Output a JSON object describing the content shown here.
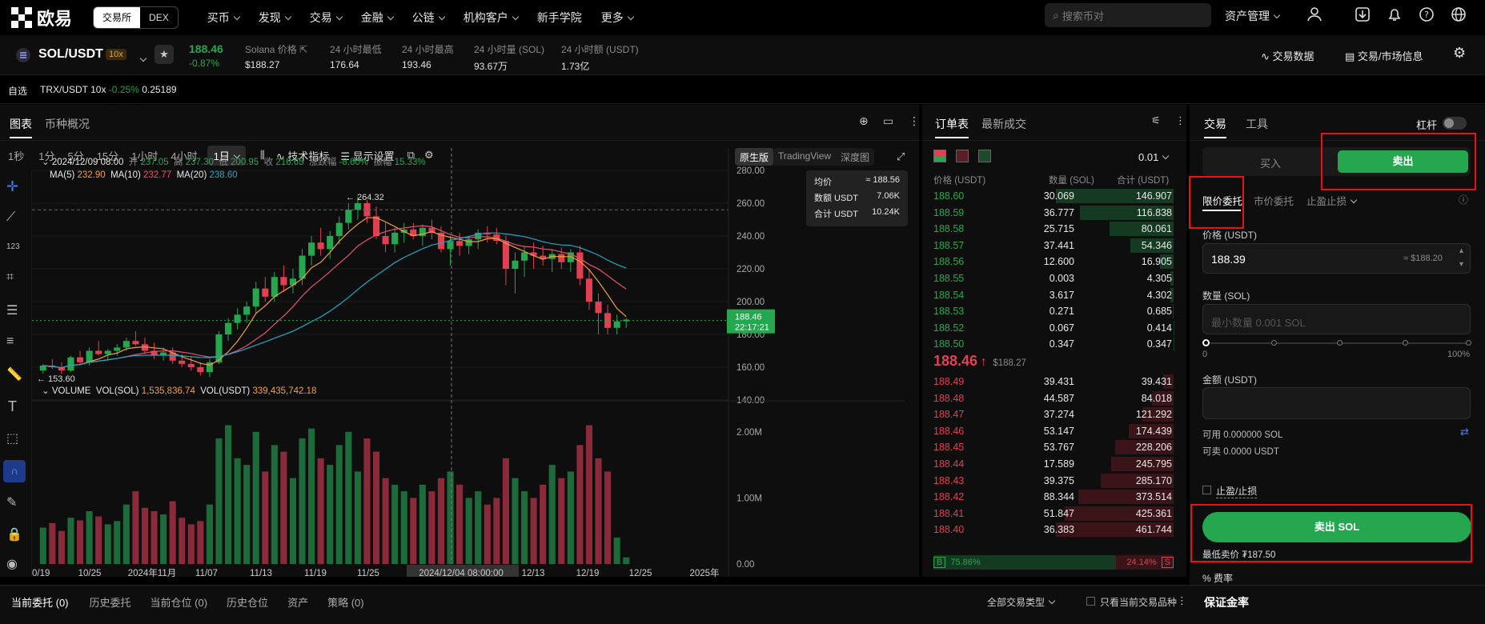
{
  "topnav": {
    "brand": "欧易",
    "seg": [
      "交易所",
      "DEX"
    ],
    "menu": [
      "买币",
      "发现",
      "交易",
      "金融",
      "公链",
      "机构客户",
      "新手学院",
      "更多"
    ],
    "search_placeholder": "搜索币对",
    "asset_menu": "资产管理"
  },
  "symbol": {
    "pair": "SOL/USDT",
    "leverage": "10x",
    "price": "188.46",
    "change": "-0.87%",
    "stats": [
      {
        "label": "Solana 价格",
        "value": "$188.27"
      },
      {
        "label": "24 小时最低",
        "value": "176.64"
      },
      {
        "label": "24 小时最高",
        "value": "193.46"
      },
      {
        "label": "24 小时量 (SOL)",
        "value": "93.67万"
      },
      {
        "label": "24 小时额 (USDT)",
        "value": "1.73亿"
      }
    ],
    "trade_data": "交易数据",
    "market_info": "交易/市场信息"
  },
  "favbar": {
    "label": "自选",
    "pair": "TRX/USDT 10x",
    "change": "-0.25%",
    "price": "0.25189"
  },
  "chart_panel": {
    "tabs": [
      "图表",
      "币种概况"
    ],
    "intervals": [
      "1秒",
      "1分",
      "5分",
      "15分",
      "1小时",
      "4小时",
      "1日"
    ],
    "indicators": "技术指标",
    "display": "显示设置",
    "views": [
      "原生版",
      "TradingView",
      "深度图"
    ]
  },
  "chart_data": {
    "type": "candlestick",
    "ohlc_header": {
      "date": "2024/12/09 08:00",
      "open_l": "开",
      "open": "237.05",
      "high_l": "高",
      "high": "237.30",
      "low_l": "低",
      "low": "200.95",
      "close_l": "收",
      "close": "216.65",
      "chg_l": "涨跌幅",
      "chg": "-8.60%",
      "amp_l": "振幅",
      "amp": "15.33%"
    },
    "ma": [
      {
        "name": "MA(5)",
        "value": "232.90",
        "color": "#f0a13a"
      },
      {
        "name": "MA(10)",
        "value": "232.77",
        "color": "#e8516e"
      },
      {
        "name": "MA(20)",
        "value": "238.60",
        "color": "#1ea7c9"
      }
    ],
    "volume_header": {
      "label": "VOLUME",
      "vol_sol_l": "VOL(SOL)",
      "vol_sol": "1,535,836.74",
      "vol_usdt_l": "VOL(USDT)",
      "vol_usdt": "339,435,742.18"
    },
    "y_ticks": [
      "280.00",
      "260.00",
      "240.00",
      "220.00",
      "200.00",
      "180.00",
      "160.00",
      "140.00"
    ],
    "vol_ticks": [
      "2.00M",
      "1.00M",
      "0.00"
    ],
    "x_ticks": [
      "0/19",
      "10/25",
      "2024年11月",
      "11/07",
      "11/13",
      "11/19",
      "11/25",
      "2024/12/04 08:00:00",
      "12/13",
      "12/19",
      "12/25",
      "2025年"
    ],
    "hi_label": "264.32",
    "lo_label": "153.60",
    "last_price": "188.46",
    "countdown": "22:17:21",
    "tooltip": [
      {
        "k": "均价",
        "v": "≈ 188.56"
      },
      {
        "k": "数额 USDT",
        "v": "7.06K"
      },
      {
        "k": "合计 USDT",
        "v": "10.24K"
      }
    ],
    "candles": [
      [
        158,
        162,
        156,
        161
      ],
      [
        161,
        165,
        159,
        160
      ],
      [
        160,
        163,
        156,
        158
      ],
      [
        158,
        167,
        157,
        166
      ],
      [
        166,
        170,
        162,
        163
      ],
      [
        163,
        172,
        161,
        170
      ],
      [
        170,
        176,
        167,
        168
      ],
      [
        168,
        171,
        164,
        170
      ],
      [
        170,
        174,
        167,
        172
      ],
      [
        172,
        178,
        170,
        176
      ],
      [
        176,
        182,
        173,
        174
      ],
      [
        174,
        178,
        168,
        170
      ],
      [
        170,
        175,
        165,
        167
      ],
      [
        167,
        172,
        164,
        169
      ],
      [
        169,
        172,
        162,
        164
      ],
      [
        164,
        168,
        160,
        162
      ],
      [
        162,
        166,
        158,
        160
      ],
      [
        160,
        163,
        155,
        157
      ],
      [
        157,
        165,
        154,
        163
      ],
      [
        163,
        182,
        162,
        180
      ],
      [
        180,
        190,
        176,
        187
      ],
      [
        187,
        196,
        183,
        192
      ],
      [
        192,
        200,
        187,
        197
      ],
      [
        197,
        212,
        193,
        208
      ],
      [
        208,
        215,
        200,
        203
      ],
      [
        203,
        218,
        200,
        215
      ],
      [
        215,
        222,
        206,
        210
      ],
      [
        210,
        220,
        205,
        214
      ],
      [
        214,
        232,
        210,
        228
      ],
      [
        228,
        240,
        222,
        236
      ],
      [
        236,
        245,
        228,
        232
      ],
      [
        232,
        243,
        226,
        240
      ],
      [
        240,
        252,
        235,
        248
      ],
      [
        248,
        260,
        244,
        256
      ],
      [
        256,
        264,
        250,
        260
      ],
      [
        260,
        262,
        248,
        252
      ],
      [
        252,
        258,
        238,
        240
      ],
      [
        240,
        248,
        230,
        235
      ],
      [
        235,
        245,
        230,
        242
      ],
      [
        242,
        248,
        236,
        244
      ],
      [
        244,
        248,
        238,
        240
      ],
      [
        240,
        247,
        234,
        245
      ],
      [
        245,
        250,
        238,
        242
      ],
      [
        242,
        246,
        230,
        232
      ],
      [
        232,
        240,
        222,
        237
      ],
      [
        237,
        242,
        228,
        234
      ],
      [
        234,
        240,
        229,
        238
      ],
      [
        238,
        244,
        232,
        242
      ],
      [
        242,
        246,
        236,
        241
      ],
      [
        241,
        245,
        235,
        237
      ],
      [
        237,
        240,
        210,
        220
      ],
      [
        220,
        230,
        205,
        225
      ],
      [
        225,
        234,
        215,
        230
      ],
      [
        230,
        236,
        220,
        228
      ],
      [
        228,
        234,
        222,
        226
      ],
      [
        226,
        232,
        218,
        229
      ],
      [
        229,
        233,
        220,
        224
      ],
      [
        224,
        232,
        218,
        230
      ],
      [
        230,
        234,
        210,
        214
      ],
      [
        214,
        220,
        195,
        200
      ],
      [
        200,
        205,
        180,
        193
      ],
      [
        193,
        198,
        180,
        184
      ],
      [
        184,
        192,
        180,
        188
      ],
      [
        188,
        190,
        184,
        189
      ]
    ],
    "volumes": [
      0.55,
      0.62,
      0.5,
      0.7,
      0.66,
      0.8,
      0.72,
      0.6,
      0.65,
      0.9,
      1.1,
      0.85,
      0.8,
      0.75,
      0.95,
      0.7,
      0.6,
      0.65,
      0.9,
      1.9,
      2.1,
      1.6,
      1.5,
      2.0,
      1.4,
      1.8,
      1.7,
      1.3,
      1.9,
      2.05,
      1.6,
      1.5,
      1.8,
      2.0,
      1.4,
      1.9,
      1.7,
      1.3,
      1.2,
      1.1,
      1.0,
      1.2,
      1.1,
      1.3,
      1.4,
      1.2,
      1.0,
      1.1,
      0.9,
      1.0,
      1.6,
      1.3,
      1.1,
      1.0,
      1.2,
      1.5,
      1.3,
      1.4,
      1.8,
      2.1,
      1.6,
      1.4,
      0.4,
      0.1
    ]
  },
  "orderbook": {
    "tabs": [
      "订单表",
      "最新成交"
    ],
    "step": "0.01",
    "headers": [
      "价格 (USDT)",
      "数量 (SOL)",
      "合计 (USDT)"
    ],
    "asks": [
      [
        "188.60",
        "30.069",
        "146.907"
      ],
      [
        "188.59",
        "36.777",
        "116.838"
      ],
      [
        "188.58",
        "25.715",
        "80.061"
      ],
      [
        "188.57",
        "37.441",
        "54.346"
      ],
      [
        "188.56",
        "12.600",
        "16.905"
      ],
      [
        "188.55",
        "0.003",
        "4.305"
      ],
      [
        "188.54",
        "3.617",
        "4.302"
      ],
      [
        "188.53",
        "0.271",
        "0.685"
      ],
      [
        "188.52",
        "0.067",
        "0.414"
      ],
      [
        "188.50",
        "0.347",
        "0.347"
      ]
    ],
    "mid_price": "188.46",
    "mid_arrow": "↑",
    "mid_ref": "$188.27",
    "bids": [
      [
        "188.49",
        "39.431",
        "39.431"
      ],
      [
        "188.48",
        "44.587",
        "84.018"
      ],
      [
        "188.47",
        "37.274",
        "121.292"
      ],
      [
        "188.46",
        "53.147",
        "174.439"
      ],
      [
        "188.45",
        "53.767",
        "228.206"
      ],
      [
        "188.44",
        "17.589",
        "245.795"
      ],
      [
        "188.43",
        "39.375",
        "285.170"
      ],
      [
        "188.42",
        "88.344",
        "373.514"
      ],
      [
        "188.41",
        "51.847",
        "425.361"
      ],
      [
        "188.40",
        "36.383",
        "461.744"
      ]
    ],
    "buy_label": "B",
    "buy_pct": "75.86%",
    "sell_pct": "24.14%",
    "sell_label": "S"
  },
  "trade": {
    "tabs": [
      "交易",
      "工具"
    ],
    "leverage_label": "杠杆",
    "buy": "买入",
    "sell": "卖出",
    "order_types": [
      "限价委托",
      "市价委托",
      "止盈止损"
    ],
    "price_label": "价格 (USDT)",
    "price_value": "188.39",
    "price_ref": "≈ $188.20",
    "qty_label": "数量 (SOL)",
    "qty_placeholder": "最小数量 0.001 SOL",
    "slider_min": "0",
    "slider_max": "100%",
    "amount_label": "金额 (USDT)",
    "available": "可用 0.000000 SOL",
    "can_sell": "可卖 0.0000 USDT",
    "tp_sl": "止盈/止损",
    "submit": "卖出 SOL",
    "min_price": "最低卖价 ₮187.50",
    "fee": "% 费率"
  },
  "bottom": {
    "tabs": [
      "当前委托 (0)",
      "历史委托",
      "当前仓位 (0)",
      "历史仓位",
      "资产",
      "策略 (0)"
    ],
    "filter": "全部交易类型",
    "current_only": "只看当前交易品种",
    "margin": "保证金率"
  }
}
